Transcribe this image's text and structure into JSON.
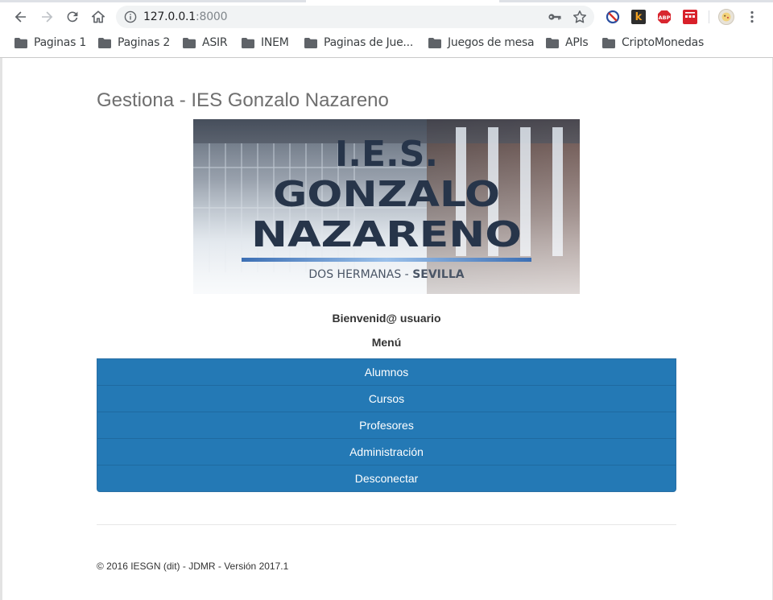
{
  "browser": {
    "url_host": "127.0.0.1",
    "url_port": ":8000",
    "bookmarks": [
      "Paginas 1",
      "Paginas 2",
      "ASIR",
      "INEM",
      "Paginas de Jue...",
      "Juegos de mesa",
      "APIs",
      "CriptoMonedas"
    ],
    "extensions": {
      "k_label": "k",
      "abp_label": "ABP"
    }
  },
  "page": {
    "title": "Gestiona - IES Gonzalo Nazareno",
    "banner": {
      "line1": "I.E.S.",
      "line2": "GONZALO",
      "line3": "NAZARENO",
      "subtitle_part1": "DOS HERMANAS - ",
      "subtitle_part2": "SEVILLA"
    },
    "welcome": "Bienvenid@ usuario",
    "menu_heading": "Menú",
    "menu_items": [
      "Alumnos",
      "Cursos",
      "Profesores",
      "Administración",
      "Desconectar"
    ],
    "footer": "© 2016 IESGN (dit) - JDMR - Versión 2017.1"
  },
  "colors": {
    "menu_background": "#2479b5",
    "title_text": "#6f6f6f"
  }
}
